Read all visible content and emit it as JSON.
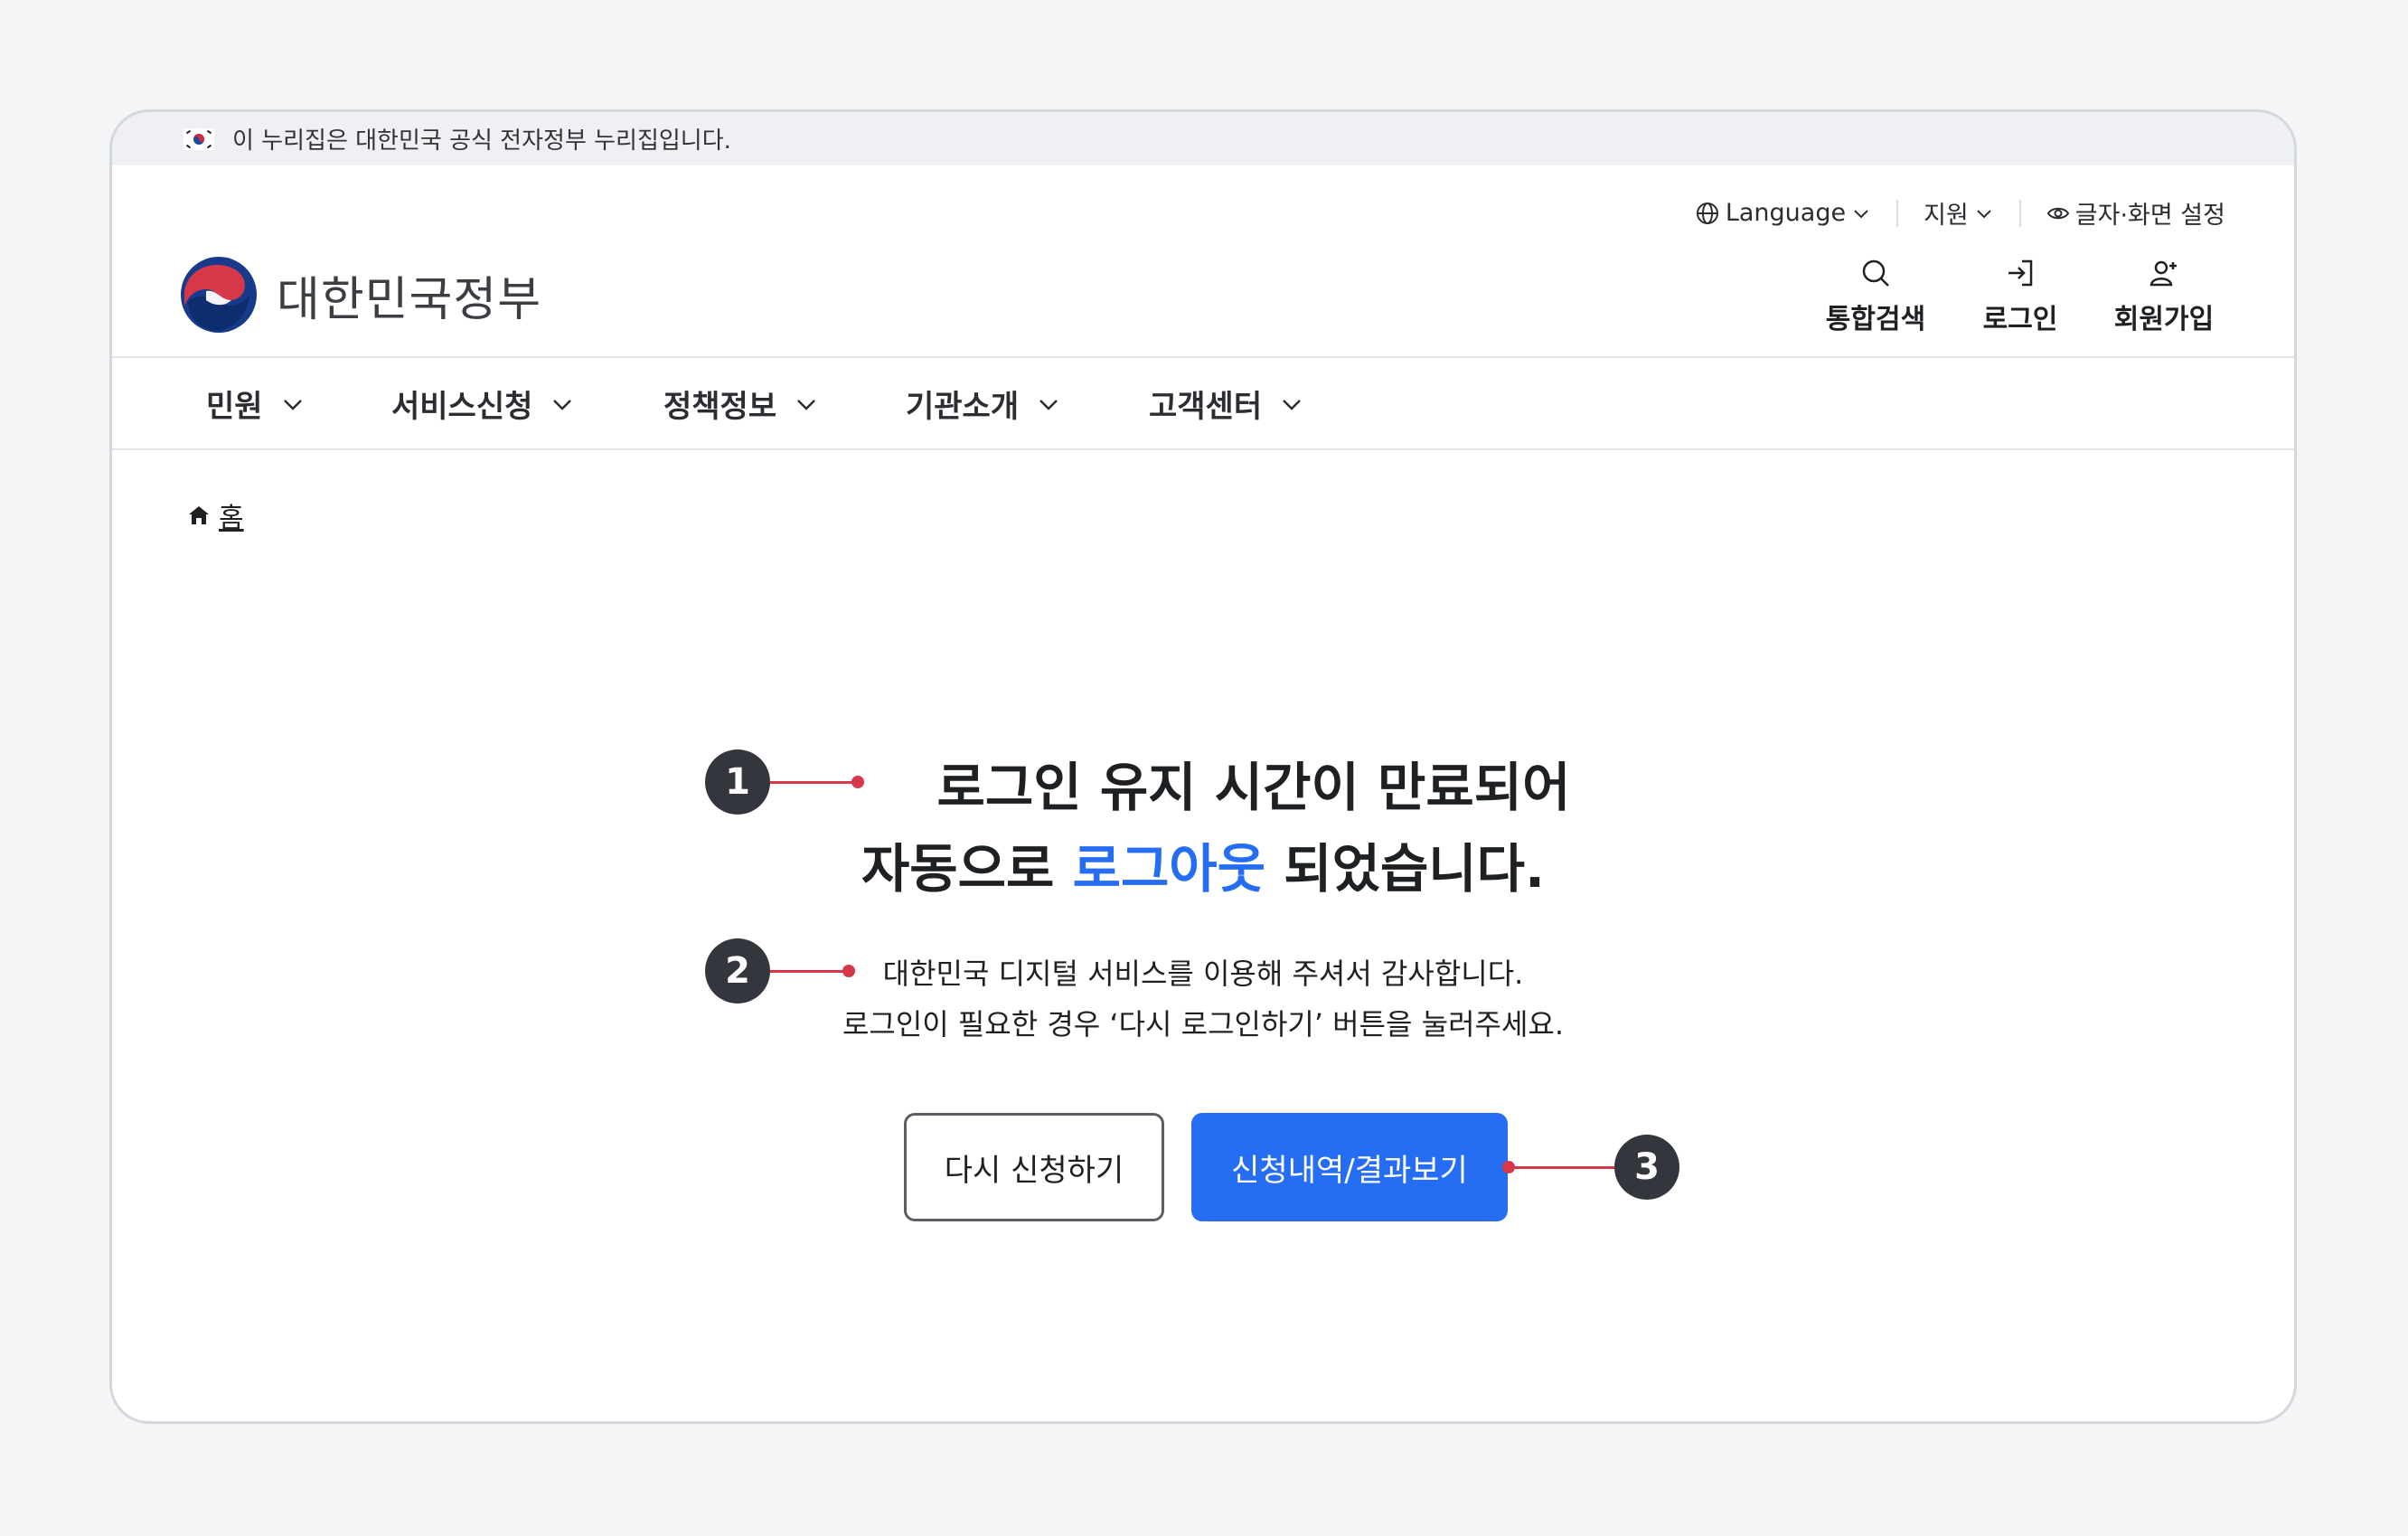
{
  "gov_banner": {
    "text": "이 누리집은 대한민국 공식 전자정부 누리집입니다."
  },
  "utility": {
    "language": "Language",
    "support": "지원",
    "display_settings": "글자·화면 설정"
  },
  "logo": {
    "text": "대한민국정부"
  },
  "quick_links": {
    "search": "통합검색",
    "login": "로그인",
    "signup": "회원가입"
  },
  "nav": {
    "items": [
      "민원",
      "서비스신청",
      "정책정보",
      "기관소개",
      "고객센터"
    ]
  },
  "breadcrumb": {
    "home": "홈"
  },
  "main": {
    "headline_line1": "로그인 유지 시간이 만료되어",
    "headline_line2_prefix": "자동으로 ",
    "headline_line2_accent": "로그아웃",
    "headline_line2_suffix": " 되었습니다.",
    "desc_line1": "대한민국 디지털 서비스를 이용해 주셔서 감사합니다.",
    "desc_line2": "로그인이 필요한 경우 ‘다시 로그인하기’ 버튼을 눌러주세요."
  },
  "buttons": {
    "retry": "다시 신청하기",
    "history": "신청내역/결과보기"
  },
  "callouts": {
    "one": "1",
    "two": "2",
    "three": "3"
  },
  "colors": {
    "accent": "#256ef4",
    "callout_line": "#d6384a",
    "callout_badge": "#33363d"
  }
}
